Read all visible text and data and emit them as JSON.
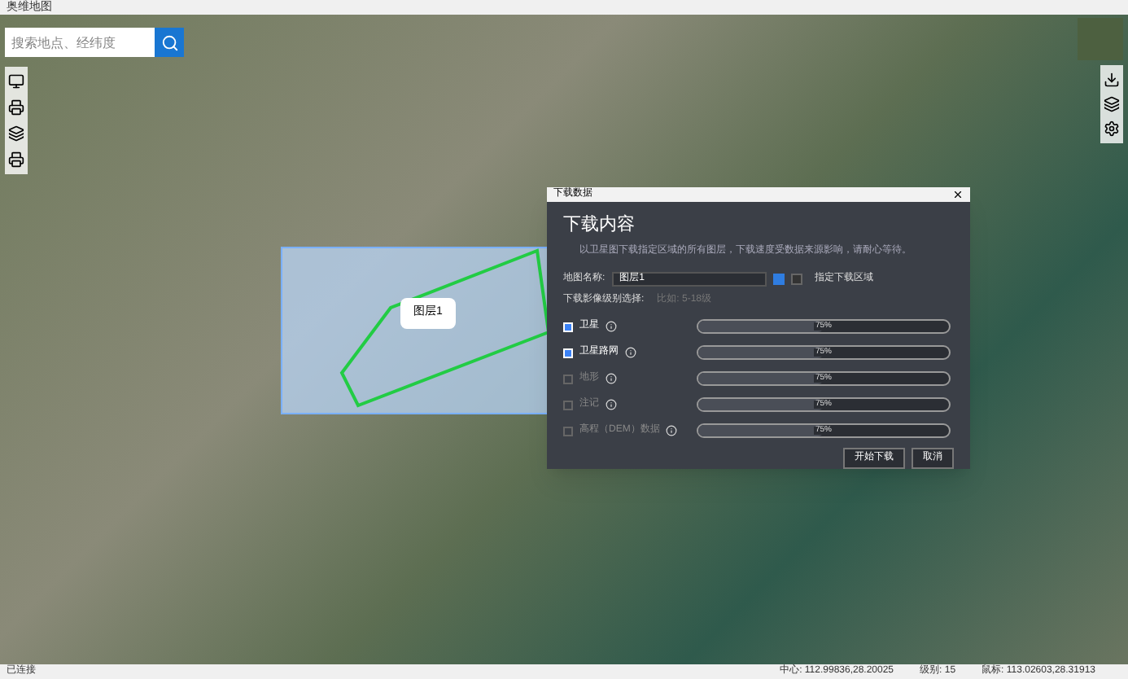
{
  "window": {
    "title": "奥维地图"
  },
  "search": {
    "placeholder": "搜索地点、经纬度"
  },
  "map": {
    "marker_label": "图层1"
  },
  "dialog": {
    "title": "下载数据",
    "heading": "下载内容",
    "description": "以卫星图下载指定区域的所有图层，下载速度受数据来源影响，请耐心等待。",
    "name_label": "地图名称:",
    "name_value": "图层1",
    "area_label": "指定下载区域",
    "level_label": "下载影像级别选择:",
    "level_placeholder": "比如: 5-18级",
    "layers": [
      {
        "label": "卫星",
        "checked": true,
        "level": 0.5,
        "reading": "75%"
      },
      {
        "label": "卫星路网",
        "checked": true,
        "level": 0.5,
        "reading": "75%"
      },
      {
        "label": "地形",
        "checked": false,
        "level": 0.5,
        "reading": "75%"
      },
      {
        "label": "注记",
        "checked": false,
        "level": 0.5,
        "reading": "75%"
      },
      {
        "label": "高程（DEM）数据",
        "checked": false,
        "level": 0.5,
        "reading": "75%"
      }
    ],
    "buttons": [
      "开始下载",
      "取消"
    ]
  },
  "status_bar": {
    "left": "已连接",
    "center": "中心: 112.99836,28.20025",
    "zoom": "级别: 15",
    "mouse": "鼠标: 113.02603,28.31913"
  }
}
